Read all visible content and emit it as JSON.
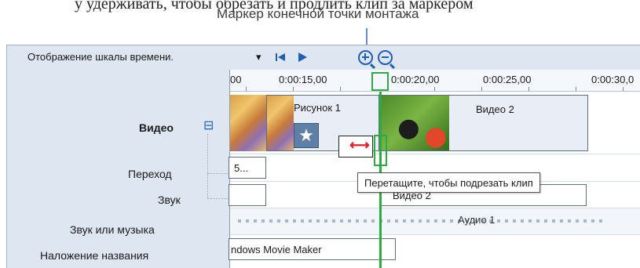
{
  "header": {
    "cut_line": "у удерживать, чтобы обрезать и продлить клип за маркером",
    "callout": "Маркер конечной точки монтажа"
  },
  "toolbar": {
    "view_dropdown": "Отображение шкалы времени.",
    "dropdown_arrow": "▾",
    "rewind_icon": "rewind-icon",
    "play_icon": "play-icon",
    "zoom_in_icon": "zoom-in-icon",
    "zoom_out_icon": "zoom-out-icon"
  },
  "tracks": {
    "video_label": "Видео",
    "collapse_glyph": "⊟",
    "transition_label": "Переход",
    "audio_label": "Звук",
    "music_label": "Звук или музыка",
    "title_overlay_label": "Наложение названия"
  },
  "ruler": {
    "ticks": [
      "00",
      "0:00:15,00",
      "0:00:20,00",
      "0:00:25,00",
      "0:00:30,0"
    ]
  },
  "clips": {
    "picture_clip": "Рисунок 1",
    "video2_clip": "Видео 2",
    "transition_clip": "5...",
    "audio_video2": "Видео 2",
    "music_clip": "Аудио 1",
    "title_clip": "ndows Movie Maker"
  },
  "tooltip": {
    "text": "Перетащите, чтобы подрезать клип"
  },
  "colors": {
    "accent_blue": "#1f5fb4",
    "marker_green": "#2eaa44",
    "trim_red": "#e0202a",
    "panel_bg": "#dde6f1"
  }
}
